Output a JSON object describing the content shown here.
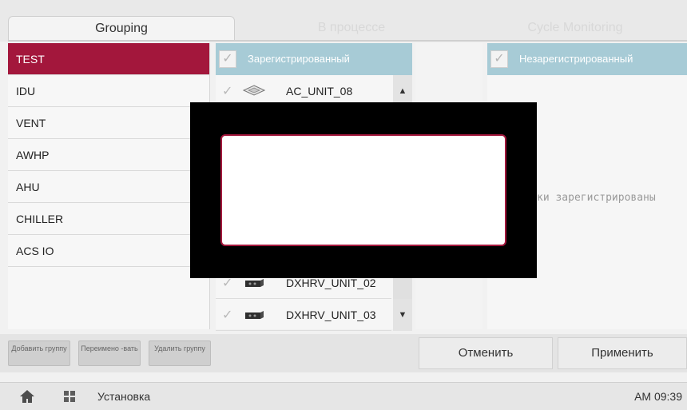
{
  "tabs": [
    "Grouping",
    "В процессе",
    "Cycle Monitoring"
  ],
  "groups": [
    "TEST",
    "IDU",
    "VENT",
    "AWHP",
    "AHU",
    "CHILLER",
    "ACS IO"
  ],
  "registered": {
    "header": "Зарегистрированный",
    "units": [
      {
        "name": "AC_UNIT_08",
        "icon": "cassette-unit-icon"
      },
      {
        "name": "DXHRV_UNIT_02",
        "icon": "dxhrv-unit-icon"
      },
      {
        "name": "DXHRV_UNIT_03",
        "icon": "dxhrv-unit-icon"
      }
    ]
  },
  "unregistered": {
    "header": "Незарегистрированный",
    "empty_message": "ки зарегистрированы"
  },
  "actions": {
    "add_group": "Добавить группу",
    "rename": "Переимено -вать",
    "delete_group": "Удалить группу",
    "cancel": "Отменить",
    "apply": "Применить"
  },
  "status": {
    "title": "Установка",
    "time": "AM 09:39"
  },
  "colors": {
    "accent": "#a3173c",
    "header": "#a7cbd6"
  }
}
